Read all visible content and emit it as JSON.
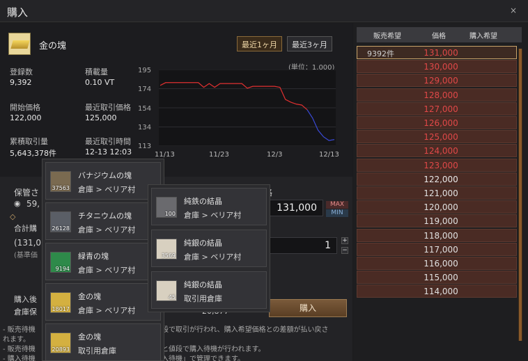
{
  "window": {
    "title": "購入",
    "close": "×"
  },
  "item": {
    "name": "金の塊"
  },
  "periods": [
    "最近1ヶ月",
    "最近3ヶ月"
  ],
  "stats": {
    "registered_label": "登録数",
    "registered_value": "9,392",
    "weight_label": "積載量",
    "weight_value": "0.10 VT",
    "start_price_label": "開始価格",
    "start_price_value": "122,000",
    "recent_price_label": "最近取引価格",
    "recent_price_value": "125,000",
    "cumulative_label": "累積取引量",
    "cumulative_value": "5,643,378件",
    "recent_time_label": "最近取引時間",
    "recent_time_value": "12-13 12:03"
  },
  "chart_data": {
    "type": "line",
    "unit_label": "(単位：1,000)",
    "x_ticks": [
      "11/13",
      "11/23",
      "12/3",
      "12/13"
    ],
    "y_ticks": [
      "195",
      "174",
      "154",
      "134",
      "113"
    ],
    "ylim": [
      113,
      195
    ],
    "series": [
      {
        "values": [
          178,
          181,
          181,
          181,
          181,
          181,
          181,
          181,
          176,
          180,
          176,
          180,
          180,
          180,
          180,
          180,
          175,
          177,
          177,
          177,
          177,
          177,
          176,
          163,
          160,
          158,
          157,
          152,
          143,
          130,
          123,
          119,
          120
        ],
        "color": "#e03030",
        "split_at": 27,
        "color_after": "#3a4ad8"
      }
    ]
  },
  "purchase": {
    "holding_label": "保管さ",
    "holding_value": "59,",
    "price_label": "格",
    "price_value": "131,000",
    "max": "MAX",
    "min": "MIN",
    "total_label": "合計購",
    "qty_value": "1",
    "paren_value": "(131,0",
    "standard_label": "(基準価",
    "after_purchase_label": "購入後",
    "warehouse_label": "倉庫保",
    "other_value": "20,877",
    "buy_button": "購入"
  },
  "notes": [
    "- 販売待機",
    "れます。",
    "- 販売待機",
    "- 購入待機",
    "段で取引が行われ、購入希望価格との差額が払い戻さ",
    "と値段で購入待機が行われます。",
    "入待機」で管理できます。"
  ],
  "warehouse_list_1": [
    {
      "name": "バナジウムの塊",
      "loc": "倉庫 > ベリア村",
      "count": "37563",
      "color": "#7a6a50"
    },
    {
      "name": "チタニウムの塊",
      "loc": "倉庫 > ベリア村",
      "count": "26128",
      "color": "#5a5e66"
    },
    {
      "name": "緑青の塊",
      "loc": "倉庫 > ベリア村",
      "count": "9194",
      "color": "#2e8a4a"
    },
    {
      "name": "金の塊",
      "loc": "倉庫 > ベリア村",
      "count": "18017",
      "color": "#d4b040"
    },
    {
      "name": "金の塊",
      "loc": "取引用倉庫",
      "count": "20893",
      "color": "#d4b040"
    }
  ],
  "warehouse_list_2": [
    {
      "name": "純鉄の結晶",
      "loc": "倉庫 > ベリア村",
      "count": "100",
      "color": "#6a6a6e"
    },
    {
      "name": "純銀の結晶",
      "loc": "倉庫 > ベリア村",
      "count": "3569",
      "color": "#d8d0c0"
    },
    {
      "name": "純銀の結晶",
      "loc": "取引用倉庫",
      "count": "45",
      "color": "#d8d0c0"
    }
  ],
  "orderbook": {
    "headers": [
      "販売希望",
      "価格",
      "購入希望"
    ],
    "rows": [
      {
        "count": "9392件",
        "price": "131,000",
        "color": "#e04848"
      },
      {
        "count": "",
        "price": "130,000",
        "color": "#e04848"
      },
      {
        "count": "",
        "price": "129,000",
        "color": "#e04848"
      },
      {
        "count": "",
        "price": "128,000",
        "color": "#e04848"
      },
      {
        "count": "",
        "price": "127,000",
        "color": "#e04848"
      },
      {
        "count": "",
        "price": "126,000",
        "color": "#e04848"
      },
      {
        "count": "",
        "price": "125,000",
        "color": "#e04848"
      },
      {
        "count": "",
        "price": "124,000",
        "color": "#e04848"
      },
      {
        "count": "",
        "price": "123,000",
        "color": "#e04848"
      },
      {
        "count": "",
        "price": "122,000",
        "color": "#e8e8e8"
      },
      {
        "count": "",
        "price": "121,000",
        "color": "#e0e0e0"
      },
      {
        "count": "",
        "price": "120,000",
        "color": "#e0e0e0"
      },
      {
        "count": "",
        "price": "119,000",
        "color": "#e0e0e0"
      },
      {
        "count": "",
        "price": "118,000",
        "color": "#e0e0e0"
      },
      {
        "count": "",
        "price": "117,000",
        "color": "#e0e0e0"
      },
      {
        "count": "",
        "price": "116,000",
        "color": "#e0e0e0"
      },
      {
        "count": "",
        "price": "115,000",
        "color": "#e0e0e0"
      },
      {
        "count": "",
        "price": "114,000",
        "color": "#e0e0e0"
      }
    ]
  }
}
